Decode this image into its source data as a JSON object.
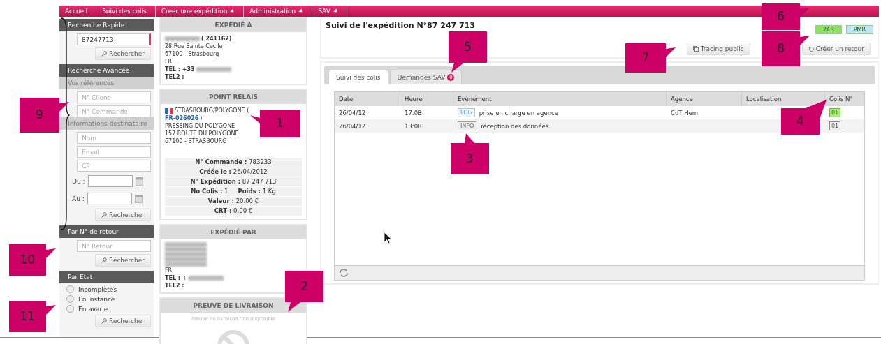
{
  "menu": [
    {
      "label": "Accueil",
      "dropdown": false
    },
    {
      "label": "Suivi des colis",
      "dropdown": false
    },
    {
      "label": "Creer une expédition",
      "dropdown": true
    },
    {
      "label": "Administration",
      "dropdown": true
    },
    {
      "label": "SAV",
      "dropdown": true
    }
  ],
  "sidebar": [
    {
      "kind": "header",
      "label": "Recherche Rapide"
    },
    {
      "kind": "field",
      "value": "87247713",
      "focused": true
    },
    {
      "kind": "button",
      "label": "Rechercher"
    },
    {
      "kind": "header",
      "label": "Recherche Avancée"
    },
    {
      "kind": "subheader",
      "label": "Vos références"
    },
    {
      "kind": "field",
      "placeholder": "N° Client",
      "focused": false
    },
    {
      "kind": "field",
      "placeholder": "N° Commande",
      "focused": false
    },
    {
      "kind": "subheader",
      "label": "Informations destinataire"
    },
    {
      "kind": "field",
      "placeholder": "Nom",
      "focused": false
    },
    {
      "kind": "field",
      "placeholder": "Email",
      "focused": false
    },
    {
      "kind": "field",
      "placeholder": "CP",
      "focused": false
    },
    {
      "kind": "date",
      "label": "Du :"
    },
    {
      "kind": "date",
      "label": "Au :"
    },
    {
      "kind": "button",
      "label": "Rechercher"
    },
    {
      "kind": "header",
      "label": "Par N° de retour"
    },
    {
      "kind": "field",
      "placeholder": "N° Retour",
      "focused": false
    },
    {
      "kind": "button",
      "label": "Rechercher"
    },
    {
      "kind": "header",
      "label": "Par Etat"
    },
    {
      "kind": "radio",
      "label": "Incomplètes",
      "selected": false
    },
    {
      "kind": "radio",
      "label": "En instance",
      "selected": false
    },
    {
      "kind": "radio",
      "label": "En avarie",
      "selected": false
    },
    {
      "kind": "button",
      "label": "Rechercher"
    }
  ],
  "panels": [
    {
      "kind": "address",
      "title": "EXPÉDIÉ À",
      "lines": [
        {
          "bold": true,
          "parts": [
            {
              "kind": "blurred"
            },
            {
              "kind": "text",
              "text": "( 241162)"
            }
          ]
        },
        {
          "bold": false,
          "parts": [
            {
              "kind": "text",
              "text": "28 Rue Sainte Cecile"
            }
          ]
        },
        {
          "bold": false,
          "parts": [
            {
              "kind": "text",
              "text": "67100 - Strasbourg"
            }
          ]
        },
        {
          "bold": false,
          "parts": [
            {
              "kind": "text",
              "text": "FR"
            }
          ]
        },
        {
          "bold": true,
          "parts": [
            {
              "kind": "text",
              "text": "TEL : +33"
            },
            {
              "kind": "blurred"
            }
          ]
        },
        {
          "bold": true,
          "parts": [
            {
              "kind": "text",
              "text": "TEL2 :"
            }
          ]
        }
      ]
    },
    {
      "kind": "relay",
      "title": "POINT RELAIS",
      "name": "STRASBOURG/POLYGONE (",
      "link": "FR-026026",
      "close": ")",
      "lines": [
        "PRESSING DU POLYGONE",
        "157 ROUTE DU POLYGONE",
        "67100 - STRASBOURG"
      ],
      "details": [
        [
          {
            "label": "N° Commande :",
            "value": "783233"
          }
        ],
        [
          {
            "label": "Créée le :",
            "value": "26/04/2012"
          }
        ],
        [
          {
            "label": "N° Expédition :",
            "value": "87 247 713"
          }
        ],
        [
          {
            "label": "No Colis :",
            "value": "1"
          },
          {
            "label": "Poids :",
            "value": "1 Kg"
          }
        ],
        [
          {
            "label": "Valeur :",
            "value": "20.00 €"
          }
        ],
        [
          {
            "label": "CRT :",
            "value": "0,00 €"
          }
        ]
      ]
    },
    {
      "kind": "address",
      "title": "EXPÉDIÉ PAR",
      "lines": [
        {
          "parts": [
            {
              "kind": "blurred"
            }
          ]
        },
        {
          "parts": [
            {
              "kind": "blurred"
            }
          ]
        },
        {
          "parts": [
            {
              "kind": "blurred"
            }
          ]
        },
        {
          "parts": [
            {
              "kind": "blurred"
            }
          ]
        },
        {
          "parts": [
            {
              "kind": "blurred"
            }
          ]
        },
        {
          "bold": false,
          "parts": [
            {
              "kind": "text",
              "text": "FR"
            }
          ]
        },
        {
          "bold": true,
          "parts": [
            {
              "kind": "text",
              "text": "TEL : +"
            },
            {
              "kind": "blurred"
            }
          ]
        },
        {
          "bold": true,
          "parts": [
            {
              "kind": "text",
              "text": "TEL2 :"
            }
          ]
        }
      ]
    },
    {
      "kind": "proof",
      "title": "PREUVE DE LIVRAISON",
      "note": "Preuve de livraison non disponible"
    }
  ],
  "shipment": {
    "title": "Suivi de l'expédition N°87 247 713",
    "badges": [
      {
        "label": "24R",
        "color": "#8fe060"
      },
      {
        "label": "PMR",
        "color": "#bfe6f7"
      }
    ],
    "tracing_button": "Tracing public",
    "return_button": "Créer un retour",
    "tabs": [
      {
        "label": "Suivi des colis",
        "selected": true
      },
      {
        "label": "Demandes SAV",
        "selected": false,
        "count": "0"
      }
    ],
    "columns": [
      "Date",
      "Heure",
      "Evènement",
      "Agence",
      "Localisation",
      "Colis N°"
    ],
    "rows": [
      {
        "date": "26/04/12",
        "time": "17:08",
        "tag": {
          "kind": "log",
          "label": "LOG"
        },
        "event": "prise en charge en agence",
        "agency": "CdT Hem",
        "parcel": {
          "kind": "scanned",
          "label": "01"
        }
      },
      {
        "date": "26/04/12",
        "time": "13:08",
        "tag": {
          "kind": "info",
          "label": "INFO"
        },
        "event": "réception des données",
        "parcel": {
          "kind": "pending",
          "label": "01"
        }
      }
    ]
  },
  "callouts": [
    "1",
    "2",
    "3",
    "4",
    "5",
    "6",
    "7",
    "8",
    "9",
    "10",
    "11"
  ]
}
